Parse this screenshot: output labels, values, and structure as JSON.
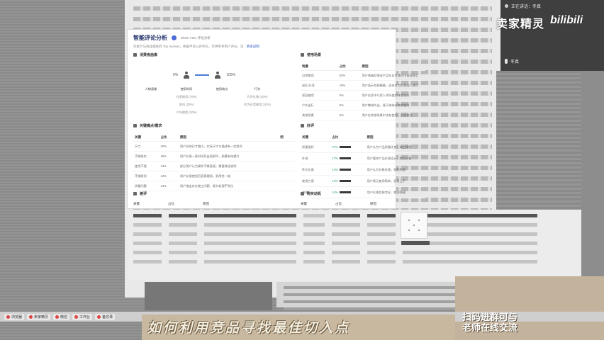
{
  "overlay": {
    "live_label": "正在讲话：冬真",
    "seller": "卖家精灵",
    "site": "bilibili",
    "speaker": "冬真"
  },
  "card": {
    "title": "智能评论分析",
    "model_label": "Shein VOC 评论分析",
    "subtitle": "仅统计与商品相关的 Top reviews，依据平台公开评论，仅供参考用户评分，见",
    "link_label": "更多说明"
  },
  "overview": {
    "title": "消费者画像",
    "left_pct": "0%",
    "right_pct": "100%",
    "right_fill": 1.0,
    "columns": [
      {
        "head": "人物画像",
        "values": []
      },
      {
        "head": "使用时间",
        "values": [
          "在家使用 (70%)",
          "室内 (20%)",
          "户外使用 (10%)"
        ]
      },
      {
        "head": "使用地点",
        "values": []
      },
      {
        "head": "行为",
        "values": [
          "作为礼物 (10%)",
          "作为日常使用 (10%)"
        ]
      }
    ]
  },
  "attention": {
    "title": "使用场景",
    "headers": [
      "场景",
      "占比",
      "原因"
    ],
    "rows": [
      {
        "a": "日常使用",
        "b": "63%",
        "c": "用户普遍反馈该产品在日常使用中表现稳定"
      },
      {
        "a": "送礼/分享",
        "b": "16%",
        "c": "用户表示包装精美，适合作为礼物送人使用"
      },
      {
        "a": "家庭使用",
        "b": "6%",
        "c": "用户在家中与家人共同使用体验较好"
      },
      {
        "a": "户外出行",
        "b": "5%",
        "c": "用户携带外出，便于收纳与携带使用"
      },
      {
        "a": "其他场景",
        "b": "5%",
        "c": "用户在其他场景中也有使用，反馈良好"
      }
    ]
  },
  "points": {
    "title": "关键痛点/需求",
    "headers": [
      "关键",
      "占比",
      "原因",
      "例"
    ],
    "rows": [
      {
        "a": "尺寸",
        "b": "22%",
        "c": "用户反映尺寸偏小，实际尺寸与描述有一定差异"
      },
      {
        "a": "不够结实",
        "b": "16%",
        "c": "用户反馈一段时间后出现损坏，质量有待提升"
      },
      {
        "a": "使用不便",
        "b": "14%",
        "c": "部分用户认为操作不够直观，需要改进说明"
      },
      {
        "a": "不够耐用",
        "b": "14%",
        "c": "用户反馈使用后容易磨损，耐用性一般"
      },
      {
        "a": "质量问题",
        "b": "14%",
        "c": "用户指出存在做工问题，细节处理不到位"
      }
    ]
  },
  "sentiment": {
    "title": "好评",
    "headers": [
      "关键",
      "占比",
      "原因"
    ],
    "rows": [
      {
        "a": "质量很好",
        "b": "27%",
        "c": "用户认为产品质量优良，做工精细"
      },
      {
        "a": "外观",
        "b": "17%",
        "c": "用户喜欢产品外观设计，颜色好看"
      },
      {
        "a": "性价比高",
        "b": "14%",
        "c": "用户认为价格合理，物超所值"
      },
      {
        "a": "使用方便",
        "b": "14%",
        "c": "用户表示使用简单，容易上手"
      },
      {
        "a": "包装好",
        "b": "14%",
        "c": "用户反馈包装完好，物流快速"
      }
    ]
  },
  "bottom": {
    "left_title": "差评",
    "right_title": "购买动机",
    "left_headers": [
      "关键",
      "占比",
      "原因"
    ],
    "right_headers": [
      "关键",
      "占比",
      "原因"
    ]
  },
  "taskbar": {
    "items": [
      "浏览器",
      "卖家精灵",
      "微信",
      "工作台",
      "备忘录"
    ]
  },
  "caption": "如何利用竞品寻找最佳切入点",
  "promo": {
    "line1": "扫码进群可与",
    "line2": "老师在线交流"
  }
}
